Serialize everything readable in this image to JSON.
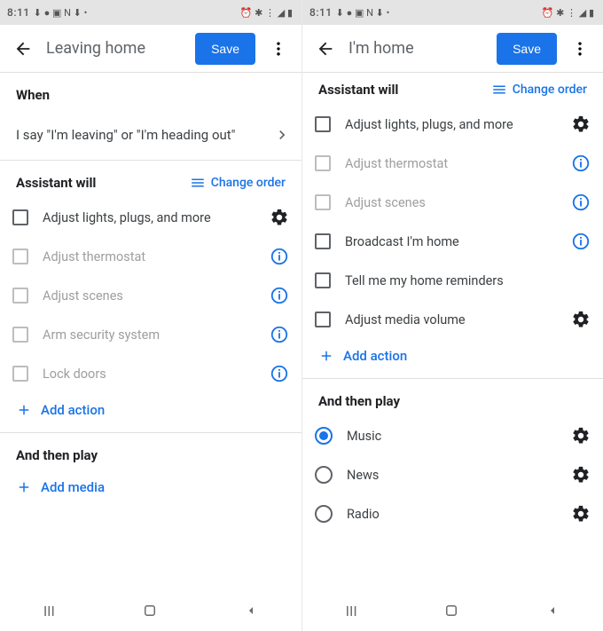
{
  "screens": [
    {
      "statusbar": {
        "time": "8:11"
      },
      "appbar": {
        "title": "Leaving home",
        "save": "Save"
      },
      "when": {
        "heading": "When",
        "trigger": "I say \"I'm leaving\" or \"I'm heading out\""
      },
      "assistant": {
        "heading": "Assistant will",
        "change_order": "Change order",
        "items": [
          {
            "label": "Adjust lights, plugs, and more",
            "disabled": false,
            "icon": "gear"
          },
          {
            "label": "Adjust thermostat",
            "disabled": true,
            "icon": "info"
          },
          {
            "label": "Adjust scenes",
            "disabled": true,
            "icon": "info"
          },
          {
            "label": "Arm security system",
            "disabled": true,
            "icon": "info"
          },
          {
            "label": "Lock doors",
            "disabled": true,
            "icon": "info"
          }
        ],
        "add_action": "Add action"
      },
      "play": {
        "heading": "And then play",
        "add_media": "Add media"
      }
    },
    {
      "statusbar": {
        "time": "8:11"
      },
      "appbar": {
        "title": "I'm home",
        "save": "Save"
      },
      "assistant": {
        "heading": "Assistant will",
        "change_order": "Change order",
        "items": [
          {
            "label": "Adjust lights, plugs, and more",
            "disabled": false,
            "icon": "gear"
          },
          {
            "label": "Adjust thermostat",
            "disabled": true,
            "icon": "info"
          },
          {
            "label": "Adjust scenes",
            "disabled": true,
            "icon": "info"
          },
          {
            "label": "Broadcast I'm home",
            "disabled": false,
            "icon": "info"
          },
          {
            "label": "Tell me my home reminders",
            "disabled": false,
            "icon": "none"
          },
          {
            "label": "Adjust media volume",
            "disabled": false,
            "icon": "gear"
          }
        ],
        "add_action": "Add action"
      },
      "play": {
        "heading": "And then play",
        "options": [
          {
            "label": "Music",
            "checked": true
          },
          {
            "label": "News",
            "checked": false
          },
          {
            "label": "Radio",
            "checked": false
          }
        ]
      }
    }
  ]
}
